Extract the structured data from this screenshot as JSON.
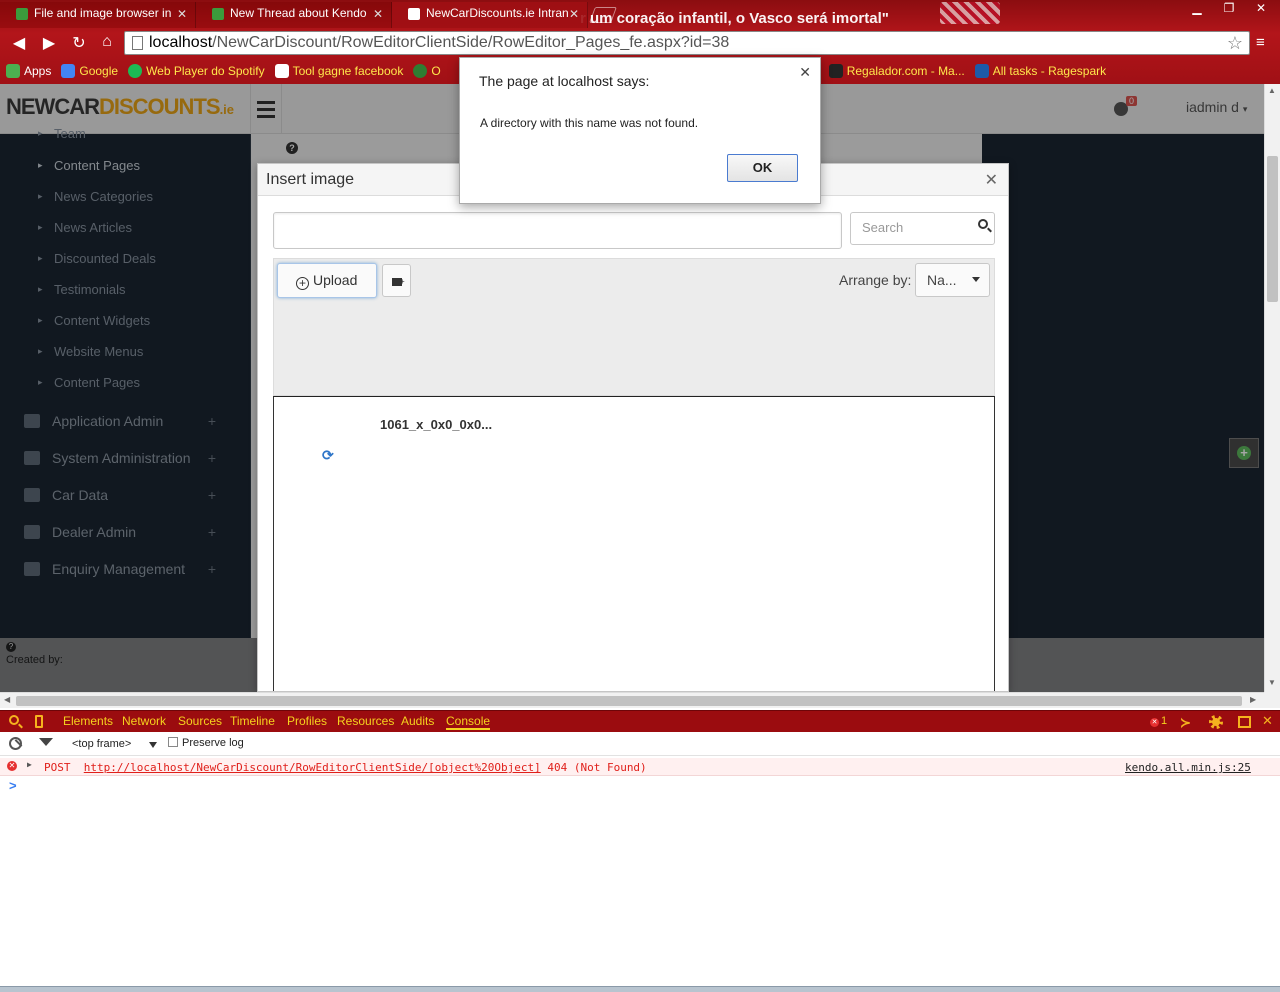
{
  "browser": {
    "tabs": [
      {
        "title": "File and image browser in",
        "active": false,
        "icon_color": "#3c9b3c"
      },
      {
        "title": "New Thread about Kendo",
        "active": false,
        "icon_color": "#3c9b3c"
      },
      {
        "title": "NewCarDiscounts.ie Intran",
        "active": true,
        "icon_color": "#ffffff"
      }
    ],
    "banner_text": "r um coração infantil, o Vasco será imortal\"",
    "url_host": "localhost",
    "url_path": "/NewCarDiscount/RowEditorClientSide/RowEditor_Pages_fe.aspx?id=38",
    "bookmarks": [
      {
        "label": "Apps",
        "color": "#4caf50",
        "style": "white"
      },
      {
        "label": "Google",
        "color": "#4285f4",
        "style": "yellow"
      },
      {
        "label": "Web Player do Spotify",
        "color": "#1db954",
        "style": "yellow"
      },
      {
        "label": "Tool gagne facebook",
        "color": "#ffffff",
        "style": "yellow"
      },
      {
        "label": "O",
        "color": "#2e7d32",
        "style": "yellow"
      },
      {
        "label": "Regalador.com - Ma...",
        "color": "#222222",
        "style": "yellow"
      },
      {
        "label": "All tasks - Ragespark",
        "color": "#1e5aa8",
        "style": "yellow"
      }
    ]
  },
  "app": {
    "brand": {
      "part1": "NEWCAR",
      "part2": "DISCOUNTS",
      "tld": ".ie"
    },
    "notifications_count": "0",
    "user": "iadmin d",
    "sidebar": {
      "sub_items": [
        {
          "label": "Team",
          "top": "-8"
        },
        {
          "label": "Content Pages",
          "active": true
        },
        {
          "label": "News Categories"
        },
        {
          "label": "News Articles"
        },
        {
          "label": "Discounted Deals"
        },
        {
          "label": "Testimonials"
        },
        {
          "label": "Content Widgets"
        },
        {
          "label": "Website Menus"
        },
        {
          "label": "Content Pages"
        }
      ],
      "sections": [
        {
          "label": "Application Admin"
        },
        {
          "label": "System Administration"
        },
        {
          "label": "Car Data"
        },
        {
          "label": "Dealer Admin"
        },
        {
          "label": "Enquiry Management"
        }
      ]
    },
    "footer_text": "Created by:"
  },
  "dialog": {
    "title": "Insert image",
    "path_value": "",
    "search_placeholder": "Search",
    "upload_label": "Upload",
    "arrange_label": "Arrange by:",
    "arrange_value": "Na...",
    "files": [
      {
        "name": "1061_x_0x0_0x0..."
      }
    ]
  },
  "alert": {
    "title": "The page at localhost says:",
    "message": "A directory with this name was not found.",
    "ok_label": "OK"
  },
  "devtools": {
    "tabs": [
      "Elements",
      "Network",
      "Sources",
      "Timeline",
      "Profiles",
      "Resources",
      "Audits",
      "Console"
    ],
    "active_tab": "Console",
    "error_count": "1",
    "frame": "<top frame>",
    "preserve_log": "Preserve log",
    "log": {
      "method": "POST",
      "url": "http://localhost/NewCarDiscount/RowEditorClientSide/[object%20Object]",
      "status": "404 (Not Found)",
      "source": "kendo.all.min.js:25"
    }
  }
}
